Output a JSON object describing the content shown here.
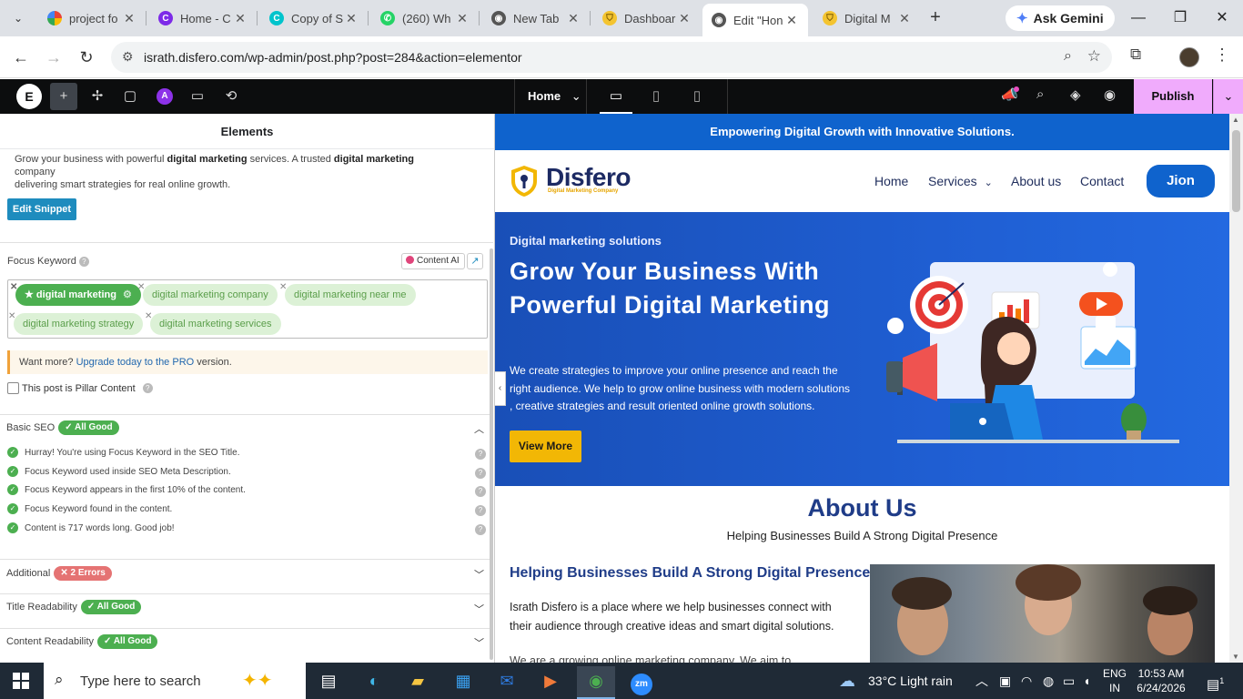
{
  "browser": {
    "tabs": [
      {
        "title": "project fo",
        "icon": "colorful-c-icon",
        "active": false
      },
      {
        "title": "Home - C",
        "icon": "canva-icon",
        "active": false
      },
      {
        "title": "Copy of S",
        "icon": "canva-icon",
        "active": false
      },
      {
        "title": "(260) Wh",
        "icon": "whatsapp-icon",
        "active": false
      },
      {
        "title": "New Tab",
        "icon": "globe-icon",
        "active": false
      },
      {
        "title": "Dashboar",
        "icon": "shield-icon",
        "active": false
      },
      {
        "title": "Edit \"Hon",
        "icon": "globe-icon",
        "active": true
      },
      {
        "title": "Digital M",
        "icon": "shield-icon",
        "active": false
      }
    ],
    "gemini_label": "Ask Gemini",
    "url": "israth.disfero.com/wp-admin/post.php?post=284&action=elementor"
  },
  "elementor": {
    "page_selector": "Home",
    "publish_label": "Publish"
  },
  "panel": {
    "title": "Elements",
    "snippet_desc_parts": [
      "Grow your business with powerful ",
      "digital marketing",
      " services. A trusted ",
      "digital marketing",
      " company",
      "delivering smart strategies for real online growth."
    ],
    "edit_snippet": "Edit Snippet",
    "focus_keyword_label": "Focus Keyword",
    "content_ai_label": "Content AI",
    "keywords": [
      "digital marketing",
      "digital marketing company",
      "digital marketing near me",
      "digital marketing strategy",
      "digital marketing services"
    ],
    "upgrade": {
      "prefix": "Want more? ",
      "link": "Upgrade today to the PRO",
      "suffix": " version."
    },
    "pillar_label": "This post is Pillar Content",
    "basic_seo": {
      "label": "Basic SEO",
      "badge": "All Good",
      "checks": [
        "Hurray! You're using Focus Keyword in the SEO Title.",
        "Focus Keyword used inside SEO Meta Description.",
        "Focus Keyword appears in the first 10% of the content.",
        "Focus Keyword found in the content.",
        "Content is 717 words long. Good job!"
      ]
    },
    "sections": [
      {
        "label": "Additional",
        "badge": "2 Errors",
        "status": "error"
      },
      {
        "label": "Title Readability",
        "badge": "All Good",
        "status": "good"
      },
      {
        "label": "Content Readability",
        "badge": "All Good",
        "status": "good"
      }
    ]
  },
  "preview": {
    "topbar": "Empowering Digital Growth with Innovative Solutions.",
    "logo_name": "Disfero",
    "logo_tagline": "Digital Marketing Company",
    "nav": [
      "Home",
      "Services",
      "About us",
      "Contact"
    ],
    "cta": "Jion",
    "hero": {
      "tag": "Digital marketing solutions",
      "title": "Grow Your Business With Powerful Digital Marketing",
      "text": "We create strategies to improve your online presence and reach the right audience. We help to grow online business with modern solutions , creative strategies and result oriented online growth solutions.",
      "button": "View More"
    },
    "about": {
      "title": "About Us",
      "subtitle": "Helping Businesses Build A Strong Digital Presence",
      "heading": "Helping Businesses Build A Strong Digital Presence",
      "para1": "Israth Disfero is a place where we help businesses connect with their audience through creative ideas and smart digital solutions.",
      "para2": "We are a growing online marketing company. We aim to"
    }
  },
  "taskbar": {
    "search_placeholder": "Type here to search",
    "weather": "33°C  Light rain",
    "lang_top": "ENG",
    "lang_bottom": "IN",
    "time": "10:53 AM",
    "date": "6/24/2026",
    "notifications": "1"
  }
}
